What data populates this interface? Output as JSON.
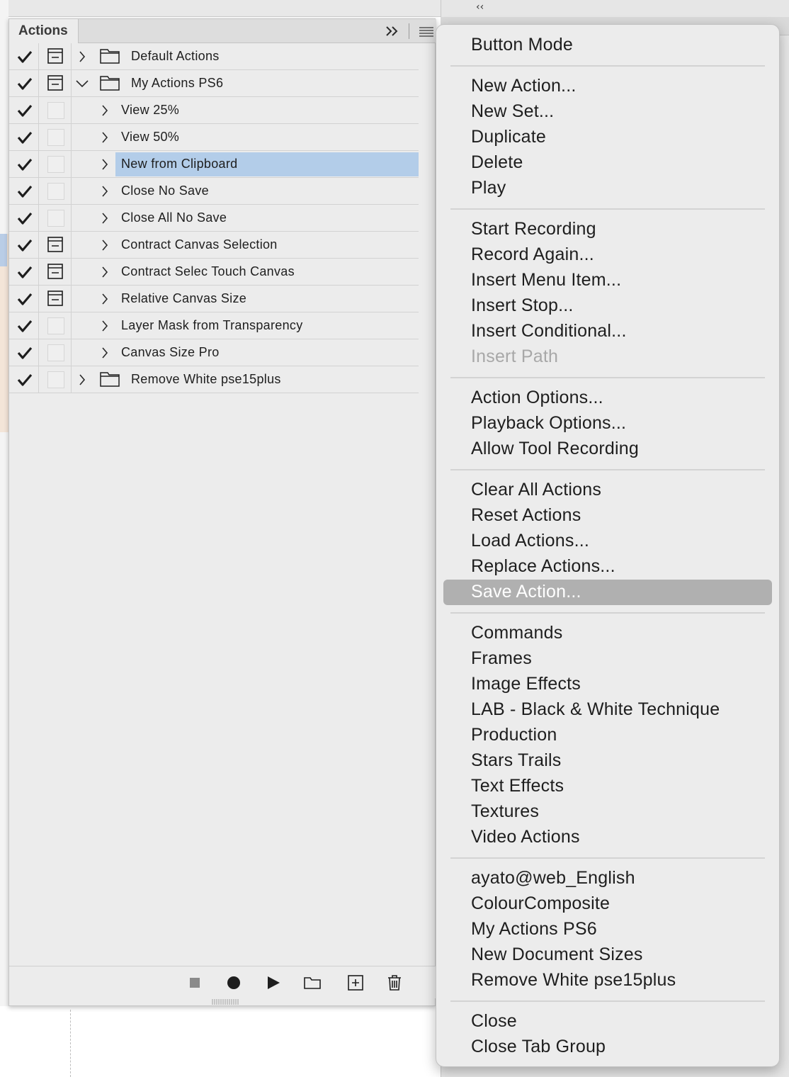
{
  "panel": {
    "title": "Actions",
    "rows": [
      {
        "label": "Default Actions",
        "checked": true,
        "dialog": true,
        "kind": "set",
        "expanded": false
      },
      {
        "label": "My Actions PS6",
        "checked": true,
        "dialog": true,
        "kind": "set",
        "expanded": true
      },
      {
        "label": "View 25%",
        "checked": true,
        "dialog": false,
        "kind": "action"
      },
      {
        "label": "View 50%",
        "checked": true,
        "dialog": false,
        "kind": "action"
      },
      {
        "label": "New from Clipboard",
        "checked": true,
        "dialog": false,
        "kind": "action",
        "selected": true
      },
      {
        "label": "Close No Save",
        "checked": true,
        "dialog": false,
        "kind": "action"
      },
      {
        "label": "Close All No Save",
        "checked": true,
        "dialog": false,
        "kind": "action"
      },
      {
        "label": "Contract Canvas Selection",
        "checked": true,
        "dialog": true,
        "kind": "action"
      },
      {
        "label": "Contract Selec Touch Canvas",
        "checked": true,
        "dialog": true,
        "kind": "action"
      },
      {
        "label": "Relative Canvas Size",
        "checked": true,
        "dialog": true,
        "kind": "action"
      },
      {
        "label": "Layer Mask from Transparency",
        "checked": true,
        "dialog": false,
        "kind": "action"
      },
      {
        "label": "Canvas Size Pro",
        "checked": true,
        "dialog": false,
        "kind": "action"
      },
      {
        "label": "Remove White pse15plus",
        "checked": true,
        "dialog": false,
        "kind": "set",
        "expanded": false
      }
    ],
    "footer_buttons": [
      "stop-icon",
      "record-icon",
      "play-icon",
      "new-set-icon",
      "new-action-icon",
      "delete-icon"
    ]
  },
  "menu": {
    "items": [
      {
        "label": "Button Mode"
      },
      {
        "label": "New Action..."
      },
      {
        "label": "New Set..."
      },
      {
        "label": "Duplicate"
      },
      {
        "label": "Delete"
      },
      {
        "label": "Play"
      },
      {
        "label": "Start Recording"
      },
      {
        "label": "Record Again..."
      },
      {
        "label": "Insert Menu Item..."
      },
      {
        "label": "Insert Stop..."
      },
      {
        "label": "Insert Conditional..."
      },
      {
        "label": "Insert Path",
        "disabled": true
      },
      {
        "label": "Action Options..."
      },
      {
        "label": "Playback Options..."
      },
      {
        "label": "Allow Tool Recording"
      },
      {
        "label": "Clear All Actions"
      },
      {
        "label": "Reset Actions"
      },
      {
        "label": "Load Actions..."
      },
      {
        "label": "Replace Actions..."
      },
      {
        "label": "Save Action...",
        "highlighted": true
      },
      {
        "label": "Commands"
      },
      {
        "label": "Frames"
      },
      {
        "label": "Image Effects"
      },
      {
        "label": "LAB - Black & White Technique"
      },
      {
        "label": "Production"
      },
      {
        "label": "Stars Trails"
      },
      {
        "label": "Text Effects"
      },
      {
        "label": "Textures"
      },
      {
        "label": "Video Actions"
      },
      {
        "label": "ayato@web_English"
      },
      {
        "label": "ColourComposite"
      },
      {
        "label": "My Actions PS6"
      },
      {
        "label": "New Document Sizes"
      },
      {
        "label": "Remove White pse15plus"
      },
      {
        "label": "Close"
      },
      {
        "label": "Close Tab Group"
      }
    ]
  },
  "colors": {
    "selection": "#b3cde9",
    "menu_highlight": "#b0b0b0",
    "panel_bg": "#ececec"
  }
}
